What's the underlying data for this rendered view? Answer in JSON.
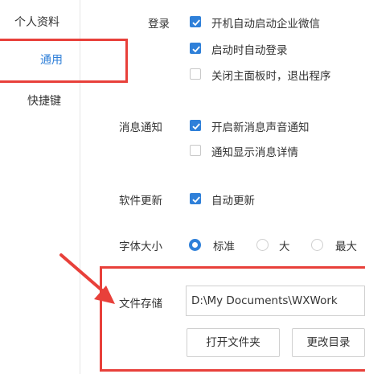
{
  "sidebar": {
    "items": [
      {
        "label": "个人资料"
      },
      {
        "label": "通用"
      },
      {
        "label": "快捷键"
      }
    ]
  },
  "settings": {
    "login": {
      "label": "登录",
      "options": [
        {
          "label": "开机自动启动企业微信",
          "checked": true
        },
        {
          "label": "启动时自动登录",
          "checked": true
        },
        {
          "label": "关闭主面板时，退出程序",
          "checked": false
        }
      ]
    },
    "notify": {
      "label": "消息通知",
      "options": [
        {
          "label": "开启新消息声音通知",
          "checked": true
        },
        {
          "label": "通知显示消息详情",
          "checked": false
        }
      ]
    },
    "update": {
      "label": "软件更新",
      "options": [
        {
          "label": "自动更新",
          "checked": true
        }
      ]
    },
    "font": {
      "label": "字体大小",
      "options": [
        {
          "label": "标准",
          "selected": true
        },
        {
          "label": "大",
          "selected": false
        },
        {
          "label": "最大",
          "selected": false
        }
      ]
    },
    "storage": {
      "label": "文件存储",
      "path": "D:\\My Documents\\WXWork",
      "open_folder_label": "打开文件夹",
      "change_dir_label": "更改目录"
    }
  },
  "colors": {
    "accent": "#2f80d9",
    "annotation_red": "#e8403a"
  }
}
